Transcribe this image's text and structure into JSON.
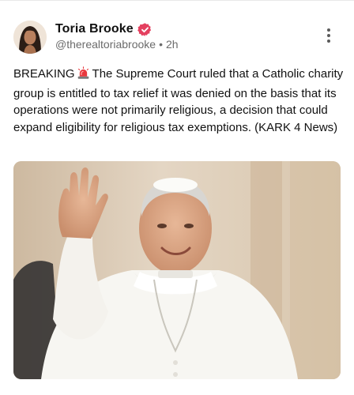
{
  "post": {
    "author": {
      "display_name": "Toria Brooke",
      "handle": "@therealtoriabrooke",
      "separator": "•",
      "time": "2h",
      "verified_icon": "verified-badge-icon",
      "verified_color": "#e4405f"
    },
    "text": {
      "prefix": "BREAKING",
      "emoji": "police-siren-emoji",
      "body": "The Supreme Court ruled that a Catholic charity group is entitled to tax relief it was denied on the basis that its operations were not primarily religious, a decision that could expand eligibility for religious tax exemptions. (KARK 4 News)"
    },
    "media": {
      "type": "photo",
      "description_icon": "photo-of-man-in-white-vestments-waving"
    },
    "more_icon": "more-vertical-icon"
  }
}
